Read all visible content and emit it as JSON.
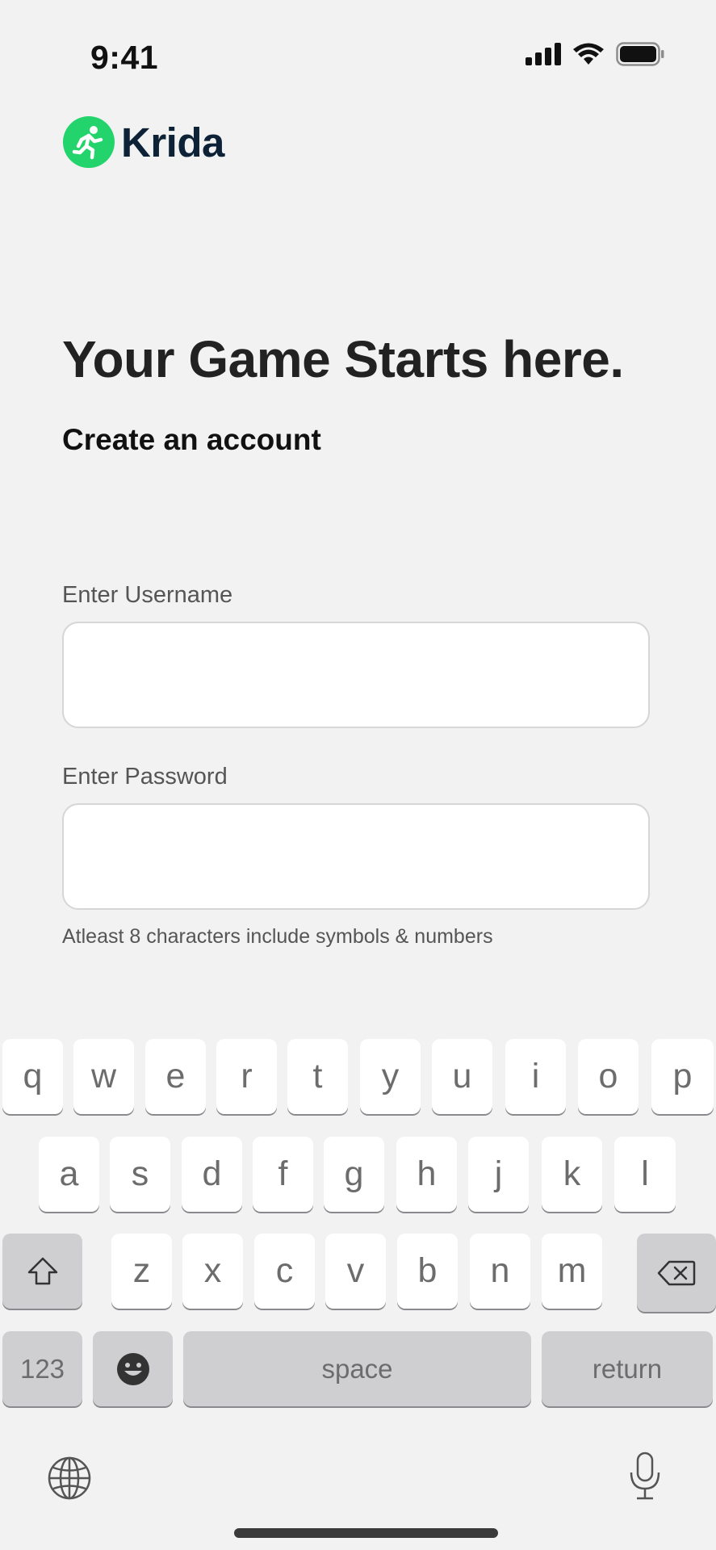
{
  "status_bar": {
    "time": "9:41"
  },
  "brand": {
    "name": "Krida",
    "color": "#22d46b"
  },
  "headline": "Your Game Starts here.",
  "subhead": "Create an account",
  "form": {
    "username_label": "Enter Username",
    "username_value": "",
    "password_label": "Enter Password",
    "password_value": "",
    "password_hint": "Atleast 8 characters include symbols & numbers"
  },
  "keyboard": {
    "row1": [
      "q",
      "w",
      "e",
      "r",
      "t",
      "y",
      "u",
      "i",
      "o",
      "p"
    ],
    "row2": [
      "a",
      "s",
      "d",
      "f",
      "g",
      "h",
      "j",
      "k",
      "l"
    ],
    "row3": [
      "z",
      "x",
      "c",
      "v",
      "b",
      "n",
      "m"
    ],
    "numbers_label": "123",
    "space_label": "space",
    "return_label": "return"
  }
}
